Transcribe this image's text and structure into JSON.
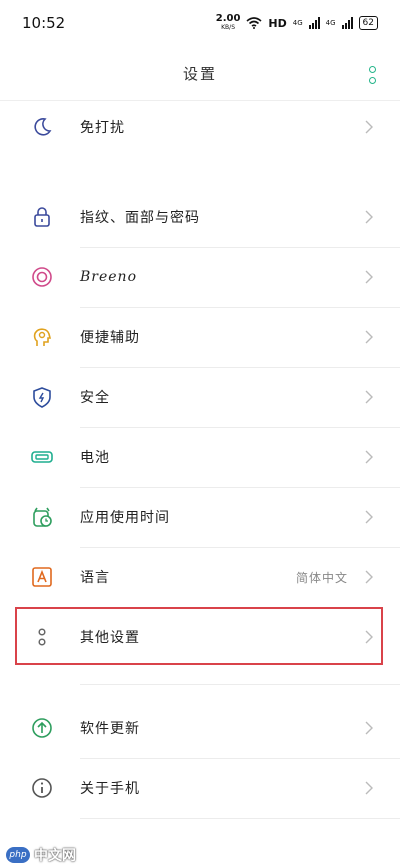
{
  "status_bar": {
    "time": "10:52",
    "speed_value": "2.00",
    "speed_unit": "KB/S",
    "hd": "HD",
    "net1": "4G",
    "net2": "4G",
    "battery": "62"
  },
  "header": {
    "title": "设置",
    "menu_icon": "more-vertical-icon"
  },
  "rows": [
    {
      "label": "免打扰",
      "icon": "moon-icon",
      "value": ""
    },
    {
      "label": "指纹、面部与密码",
      "icon": "lock-icon",
      "value": ""
    },
    {
      "label": "Breeno",
      "icon": "breeno-icon",
      "value": ""
    },
    {
      "label": "便捷辅助",
      "icon": "assist-head-icon",
      "value": ""
    },
    {
      "label": "安全",
      "icon": "shield-icon",
      "value": ""
    },
    {
      "label": "电池",
      "icon": "battery-icon",
      "value": ""
    },
    {
      "label": "应用使用时间",
      "icon": "app-usage-icon",
      "value": ""
    },
    {
      "label": "语言",
      "icon": "language-icon",
      "value": "简体中文"
    },
    {
      "label": "其他设置",
      "icon": "more-dots-icon",
      "value": ""
    },
    {
      "label": "软件更新",
      "icon": "update-arrow-icon",
      "value": ""
    },
    {
      "label": "关于手机",
      "icon": "info-icon",
      "value": ""
    }
  ],
  "watermark": {
    "logo": "php",
    "text": "中文网"
  },
  "colors": {
    "accent_green": "#25b58a",
    "highlight_red": "#d9434a"
  }
}
